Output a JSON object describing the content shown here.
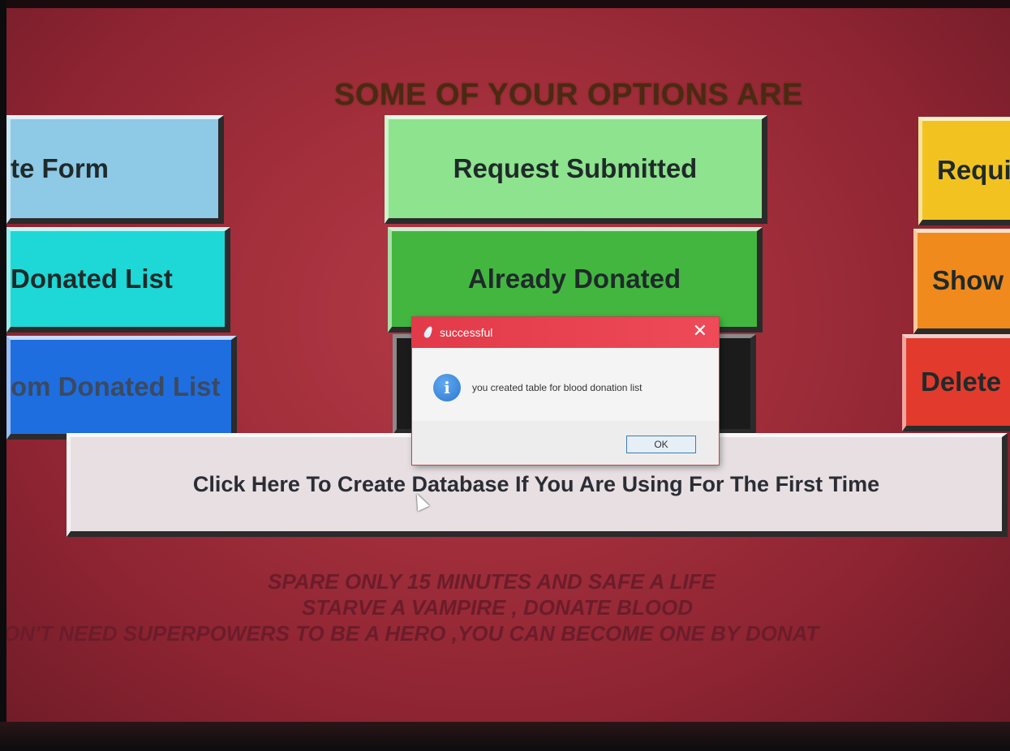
{
  "main": {
    "heading": "SOME OF YOUR OPTIONS ARE",
    "buttons": {
      "donate_form": "te Form",
      "donated_list": "Donated List",
      "delete_from_donated": "om Donated List",
      "request_submitted": "Request Submitted",
      "already_donated": "Already Donated",
      "required": "Requi",
      "show": "Show",
      "delete": "Delete",
      "create_database": "Click Here To Create Database If You Are Using For The First Time"
    },
    "slogans": [
      "SPARE ONLY 15 MINUTES AND SAFE A LIFE",
      "STARVE A VAMPIRE , DONATE BLOOD",
      "ON'T NEED SUPERPOWERS TO BE A HERO ,YOU CAN BECOME ONE BY DONAT"
    ]
  },
  "dialog": {
    "title": "successful",
    "message": "you created table for blood donation list",
    "ok_label": "OK",
    "close_glyph": "✕",
    "icon": "info-icon",
    "icon_glyph": "i"
  },
  "colors": {
    "background": "#a22f3b",
    "dialog_titlebar": "#e23a48"
  }
}
